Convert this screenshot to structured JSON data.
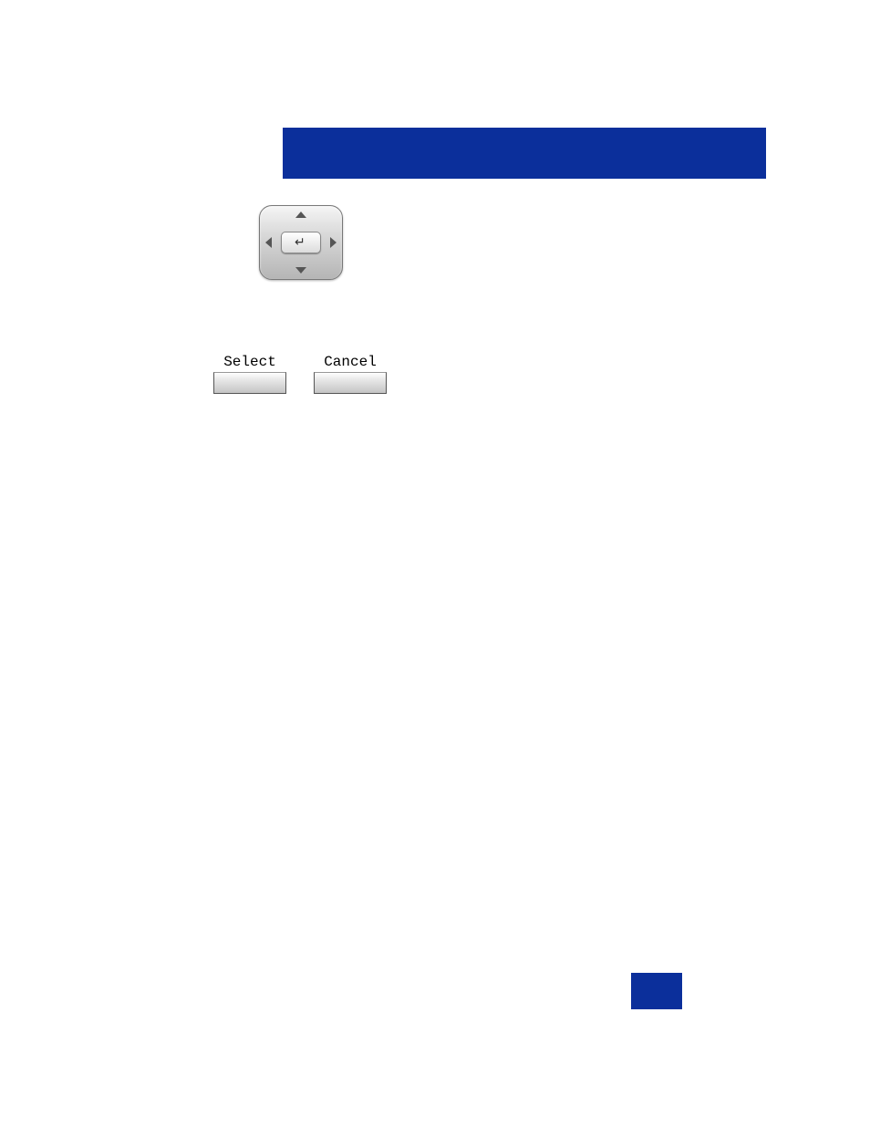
{
  "banner": {
    "text": ""
  },
  "nav_pad": {
    "up": "up",
    "down": "down",
    "left": "left",
    "right": "right",
    "center": "enter"
  },
  "soft_buttons": {
    "left_label": "Select",
    "right_label": "Cancel"
  },
  "page_number": ""
}
